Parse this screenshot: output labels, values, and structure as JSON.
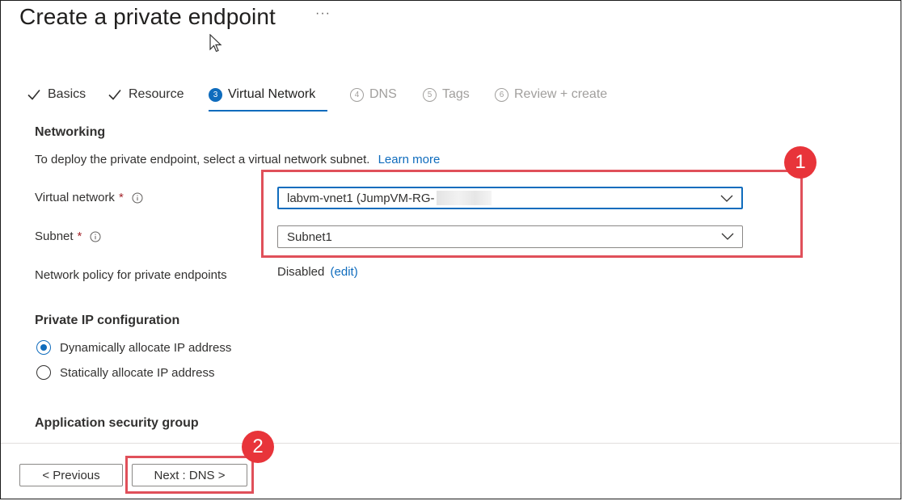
{
  "page": {
    "title": "Create a private endpoint",
    "more": "···"
  },
  "tabs": [
    {
      "label": "Basics",
      "state": "completed",
      "marker": "check"
    },
    {
      "label": "Resource",
      "state": "completed",
      "marker": "check"
    },
    {
      "label": "Virtual Network",
      "state": "active",
      "marker": "3"
    },
    {
      "label": "DNS",
      "state": "disabled",
      "marker": "4"
    },
    {
      "label": "Tags",
      "state": "disabled",
      "marker": "5"
    },
    {
      "label": "Review + create",
      "state": "disabled",
      "marker": "6"
    }
  ],
  "networking": {
    "heading": "Networking",
    "description": "To deploy the private endpoint, select a virtual network subnet.",
    "learn_more": "Learn more",
    "vnet_label": "Virtual network",
    "vnet_value": "labvm-vnet1 (JumpVM-RG-",
    "subnet_label": "Subnet",
    "subnet_value": "Subnet1",
    "required_marker": "*",
    "policy_label": "Network policy for private endpoints",
    "policy_value": "Disabled",
    "policy_edit": "(edit)"
  },
  "ip_config": {
    "heading": "Private IP configuration",
    "options": [
      {
        "label": "Dynamically allocate IP address",
        "selected": true
      },
      {
        "label": "Statically allocate IP address",
        "selected": false
      }
    ]
  },
  "asg": {
    "heading": "Application security group"
  },
  "footer": {
    "previous_label": "< Previous",
    "next_label": "Next : DNS >"
  },
  "annotations": {
    "badge1": "1",
    "badge2": "2"
  },
  "colors": {
    "accent": "#0f6cbd",
    "callout": "#e0505a",
    "badge": "#e8343a",
    "required": "#a4262c"
  },
  "icons": {
    "completed_tab": "checkmark-icon",
    "field_info": "info-icon",
    "dropdown": "chevron-down-icon",
    "cursor": "mouse-pointer-icon"
  }
}
